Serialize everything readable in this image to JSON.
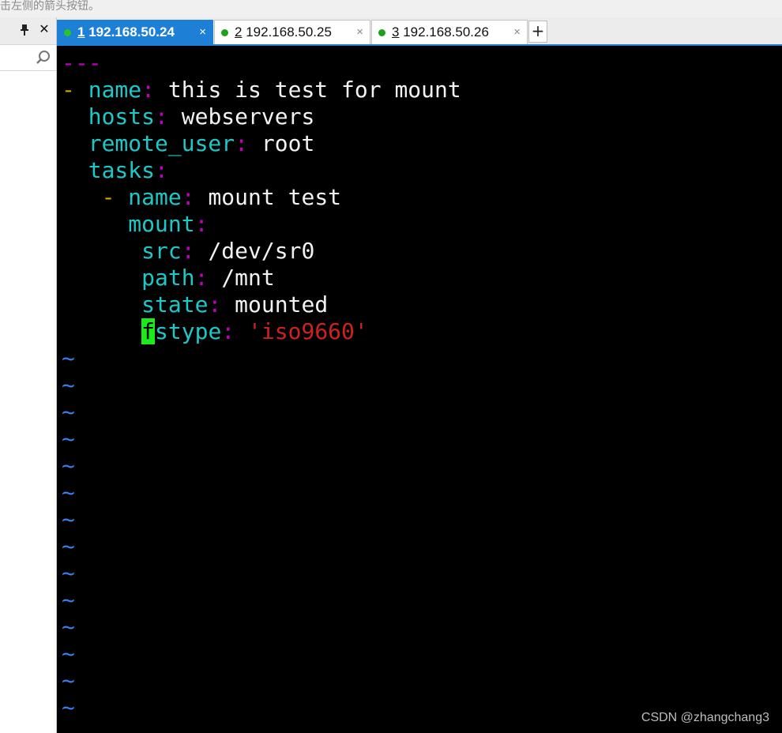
{
  "hint_text": "击左侧的箭头按钮。",
  "left_panel": {
    "pin_glyph": "📌",
    "close_glyph": "✕"
  },
  "tabs": [
    {
      "num": "1",
      "host": "192.168.50.24",
      "active": true,
      "close": "×"
    },
    {
      "num": "2",
      "host": "192.168.50.25",
      "active": false,
      "close": "×"
    },
    {
      "num": "3",
      "host": "192.168.50.26",
      "active": false,
      "close": "×"
    }
  ],
  "add_tab_label": "+",
  "terminal": {
    "yaml_start": "---",
    "lines": {
      "l1_dash": "- ",
      "l1_key": "name",
      "l1_val": "this is test for mount",
      "l2_key": "hosts",
      "l2_val": "webservers",
      "l3_key": "remote_user",
      "l3_val": "root",
      "l4_key": "tasks",
      "l5_dash": "- ",
      "l5_key": "name",
      "l5_val": "mount test",
      "l6_key": "mount",
      "l7_key": "src",
      "l7_val": "/dev/sr0",
      "l8_key": "path",
      "l8_val": "/mnt",
      "l9_key": "state",
      "l9_val": "mounted",
      "l10_cursor_char": "f",
      "l10_key_rest": "stype",
      "l10_val": "'iso9660'"
    },
    "colon": ":",
    "tilde": "~"
  },
  "watermark": "CSDN @zhangchang3",
  "colors": {
    "tab_active": "#1e7fd6",
    "yaml_key": "#1cc8c8",
    "yaml_punct": "#c000c0",
    "yaml_string": "#d02020",
    "vim_tilde": "#3a7ff0",
    "cursor": "#1bea1b"
  }
}
